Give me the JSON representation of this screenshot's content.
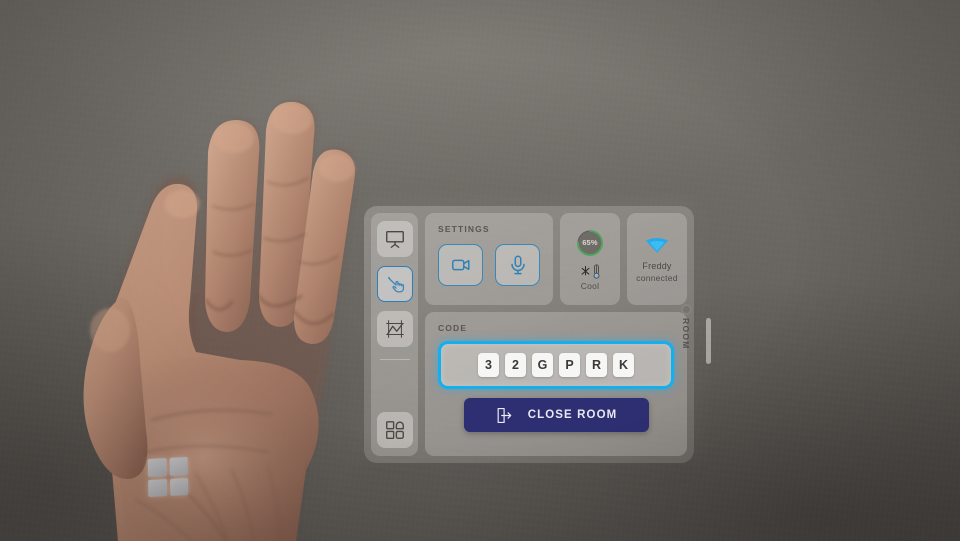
{
  "scene": {
    "environment": "grey-wall",
    "overlay_kind": "augmented-reality-projected-panel",
    "hand_gesture": "open-palm",
    "wrist_logo": "windows-logo"
  },
  "panel": {
    "rail": {
      "items": [
        {
          "name": "whiteboard",
          "icon": "whiteboard-icon",
          "active": false
        },
        {
          "name": "pointer",
          "icon": "pointing-hand-icon",
          "active": true
        },
        {
          "name": "chart",
          "icon": "chart-icon",
          "active": false
        },
        {
          "name": "apps",
          "icon": "apps-grid-icon",
          "active": false
        }
      ]
    },
    "settings": {
      "label": "SETTINGS",
      "toggles": [
        {
          "name": "camera",
          "icon": "video-camera-icon"
        },
        {
          "name": "microphone",
          "icon": "microphone-icon"
        }
      ]
    },
    "climate": {
      "percent": "65%",
      "percent_value": 65,
      "mode": "Cool",
      "icon": "snowflake-thermometer-icon",
      "ring_color": "#4ba85a"
    },
    "network": {
      "ssid": "Freddy",
      "status": "connected",
      "icon": "wifi-icon",
      "icon_color": "#25a6e8"
    },
    "code": {
      "label": "CODE",
      "characters": [
        "3",
        "2",
        "G",
        "P",
        "R",
        "K"
      ],
      "highlight_color": "#13b0f0"
    },
    "close_room": {
      "label": "CLOSE ROOM",
      "icon": "exit-door-icon",
      "color": "#2e2f72"
    },
    "side_tab": {
      "label": "ROOM"
    }
  }
}
